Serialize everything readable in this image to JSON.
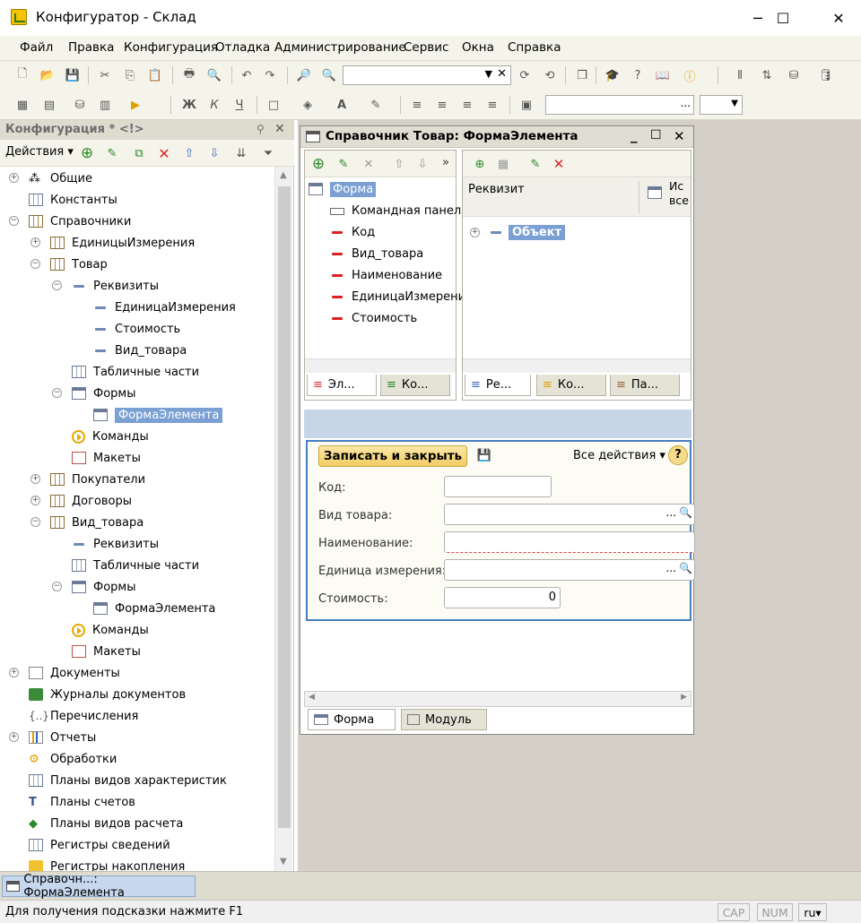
{
  "window": {
    "title": "Конфигуратор - Склад",
    "controls": [
      "─",
      "☐",
      "✕"
    ]
  },
  "menu": [
    "Файл",
    "Правка",
    "Конфигурация",
    "Отладка",
    "Администрирование",
    "Сервис",
    "Окна",
    "Справка"
  ],
  "left_panel": {
    "title": "Конфигурация * <!>",
    "actions_label": "Действия",
    "tree": [
      {
        "label": "Общие",
        "icon": "shapes-icon"
      },
      {
        "label": "Константы",
        "icon": "constants-icon"
      },
      {
        "label": "Справочники",
        "icon": "catalog-icon"
      },
      {
        "label": "ЕдиницыИзмерения",
        "icon": "catalog-icon"
      },
      {
        "label": "Товар",
        "icon": "catalog-icon"
      },
      {
        "label": "Реквизиты",
        "icon": "attribute-icon"
      },
      {
        "label": "ЕдиницаИзмерения",
        "icon": "attribute-icon"
      },
      {
        "label": "Стоимость",
        "icon": "attribute-icon"
      },
      {
        "label": "Вид_товара",
        "icon": "attribute-icon"
      },
      {
        "label": "Табличные части",
        "icon": "table-icon"
      },
      {
        "label": "Формы",
        "icon": "form-icon"
      },
      {
        "label": "ФормаЭлемента",
        "icon": "form-icon",
        "selected": true
      },
      {
        "label": "Команды",
        "icon": "command-icon"
      },
      {
        "label": "Макеты",
        "icon": "template-icon"
      },
      {
        "label": "Покупатели",
        "icon": "catalog-icon"
      },
      {
        "label": "Договоры",
        "icon": "catalog-icon"
      },
      {
        "label": "Вид_товара",
        "icon": "catalog-icon"
      },
      {
        "label": "Реквизиты",
        "icon": "attribute-icon"
      },
      {
        "label": "Табличные части",
        "icon": "table-icon"
      },
      {
        "label": "Формы",
        "icon": "form-icon"
      },
      {
        "label": "ФормаЭлемента",
        "icon": "form-icon"
      },
      {
        "label": "Команды",
        "icon": "command-icon"
      },
      {
        "label": "Макеты",
        "icon": "template-icon"
      },
      {
        "label": "Документы",
        "icon": "document-icon"
      },
      {
        "label": "Журналы документов",
        "icon": "journal-icon"
      },
      {
        "label": "Перечисления",
        "icon": "enum-icon"
      },
      {
        "label": "Отчеты",
        "icon": "report-icon"
      },
      {
        "label": "Обработки",
        "icon": "processing-icon"
      },
      {
        "label": "Планы видов характеристик",
        "icon": "chart-types-icon"
      },
      {
        "label": "Планы счетов",
        "icon": "accounts-icon"
      },
      {
        "label": "Планы видов расчета",
        "icon": "calc-types-icon"
      },
      {
        "label": "Регистры сведений",
        "icon": "info-register-icon"
      },
      {
        "label": "Регистры накопления",
        "icon": "accum-register-icon"
      }
    ]
  },
  "form_window": {
    "title": "Справочник Товар: ФормаЭлемента",
    "elements_tree": [
      {
        "label": "Форма",
        "selected": true
      },
      {
        "label": "Командная панель"
      },
      {
        "label": "Код"
      },
      {
        "label": "Вид_товара"
      },
      {
        "label": "Наименование"
      },
      {
        "label": "ЕдиницаИзмерения"
      },
      {
        "label": "Стоимость"
      }
    ],
    "attributes_header": "Реквизит",
    "attributes_header2": "Ис все",
    "attributes": [
      {
        "label": "Объект",
        "selected": true
      }
    ],
    "left_tabs": [
      "Эл...",
      "Ко..."
    ],
    "right_tabs": [
      "Ре...",
      "Ко...",
      "Па..."
    ],
    "preview": {
      "save_close": "Записать и закрыть",
      "all_actions": "Все действия",
      "help": "?",
      "fields": [
        {
          "label": "Код:",
          "value": ""
        },
        {
          "label": "Вид товара:",
          "value": ""
        },
        {
          "label": "Наименование:",
          "value": ""
        },
        {
          "label": "Единица измерения:",
          "value": ""
        },
        {
          "label": "Стоимость:",
          "value": "0"
        }
      ]
    },
    "bottom_tabs": [
      "Форма",
      "Модуль"
    ]
  },
  "taskbar": {
    "item": "Справочн...: ФормаЭлемента"
  },
  "status": {
    "hint": "Для получения подсказки нажмите F1",
    "cap": "CAP",
    "num": "NUM",
    "lang": "ru"
  }
}
